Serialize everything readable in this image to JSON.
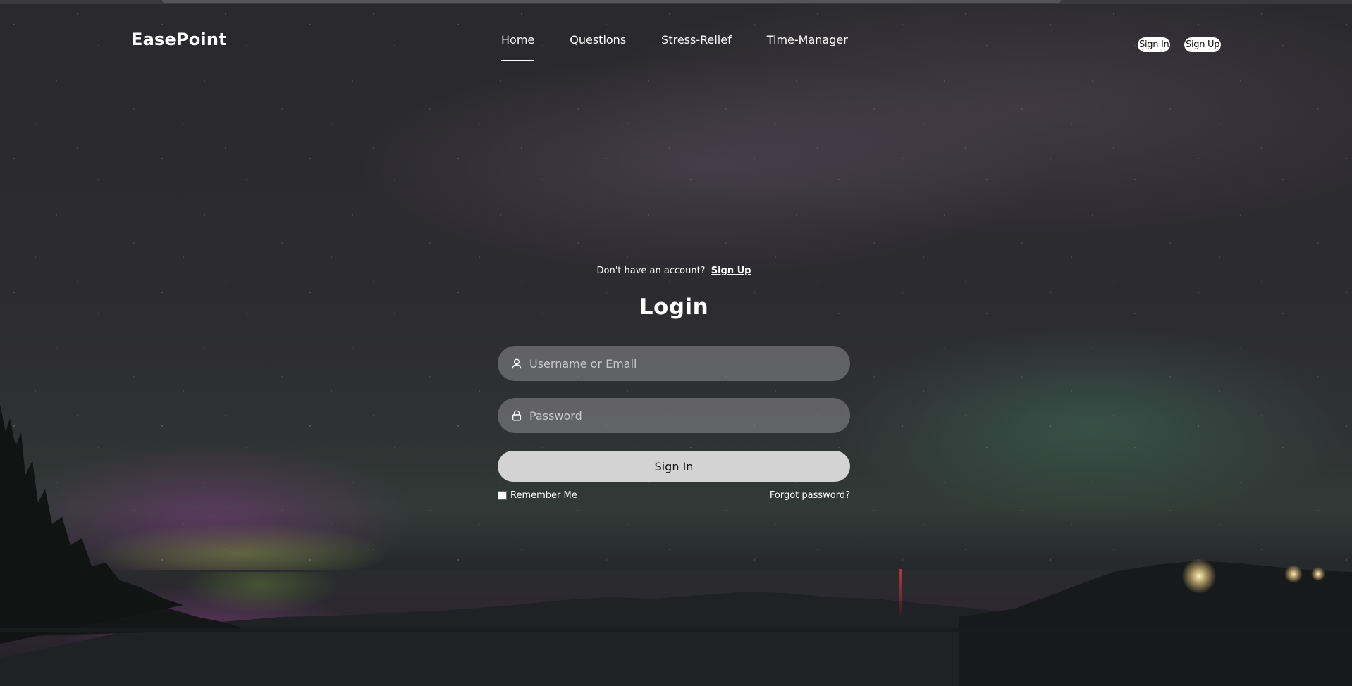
{
  "brand": {
    "name": "EasePoint"
  },
  "nav": {
    "items": [
      {
        "label": "Home",
        "active": true
      },
      {
        "label": "Questions",
        "active": false
      },
      {
        "label": "Stress-Relief",
        "active": false
      },
      {
        "label": "Time-Manager",
        "active": false
      }
    ]
  },
  "header_actions": {
    "sign_in": "Sign In",
    "sign_up": "Sign Up"
  },
  "login": {
    "prompt_text": "Don't have an account?",
    "prompt_link": "Sign Up",
    "title": "Login",
    "username_placeholder": "Username or Email",
    "password_placeholder": "Password",
    "submit_label": "Sign In",
    "remember_label": "Remember Me",
    "remember_checked": false,
    "forgot_label": "Forgot password?"
  },
  "icons": {
    "username": "user-icon",
    "password": "lock-icon"
  },
  "colors": {
    "text": "#ffffff",
    "field_bg": "#8c8c91",
    "button_bg": "#d3d3d3"
  }
}
